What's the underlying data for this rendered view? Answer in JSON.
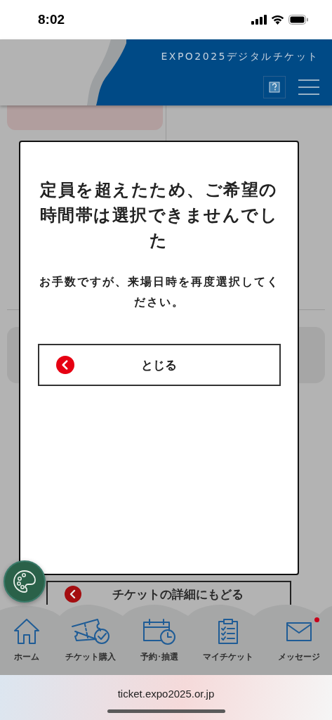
{
  "status_bar": {
    "time": "8:02"
  },
  "header": {
    "title": "EXPO2025デジタルチケット"
  },
  "dialog": {
    "title": "定員を超えたため、ご希望の時間帯は選択できませんでした",
    "message": "お手数ですが、来場日時を再度選択してください。",
    "close_button": "とじる"
  },
  "back_button": "チケットの詳細にもどる",
  "bottom_nav": [
    {
      "label": "ホーム",
      "kind": "home",
      "notification": false
    },
    {
      "label": "チケット購入",
      "kind": "ticket",
      "notification": false
    },
    {
      "label": "予約･抽選",
      "kind": "calendar",
      "notification": false
    },
    {
      "label": "マイチケット",
      "kind": "clipboard",
      "notification": false
    },
    {
      "label": "メッセージ",
      "kind": "mail",
      "notification": true
    }
  ],
  "browser_bar": {
    "url": "ticket.expo2025.or.jp"
  }
}
